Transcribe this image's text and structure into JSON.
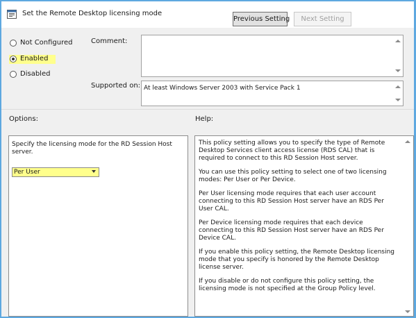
{
  "title": "Set the Remote Desktop licensing mode",
  "buttons": {
    "previous": "Previous Setting",
    "next": "Next Setting"
  },
  "state": {
    "options": [
      "Not Configured",
      "Enabled",
      "Disabled"
    ],
    "selected": "Enabled"
  },
  "comment": {
    "label": "Comment:",
    "value": ""
  },
  "supported_on": {
    "label": "Supported on:",
    "value": "At least Windows Server 2003 with Service Pack 1"
  },
  "options_panel": {
    "heading": "Options:",
    "description": "Specify the licensing mode for the RD Session Host server.",
    "licensing_mode": {
      "selected": "Per User"
    }
  },
  "help_panel": {
    "heading": "Help:",
    "paragraphs": [
      "This policy setting allows you to specify the type of Remote Desktop Services client access license (RDS CAL) that is required to connect to this RD Session Host server.",
      "You can use this policy setting to select one of two licensing modes: Per User or Per Device.",
      "Per User licensing mode requires that each user account connecting to this RD Session Host server have an RDS Per User CAL.",
      "Per Device licensing mode requires that each device connecting to this RD Session Host server have an RDS Per Device CAL.",
      "If you enable this policy setting, the Remote Desktop licensing mode that you specify is honored by the Remote Desktop license server.",
      "If you disable or do not configure this policy setting, the licensing mode is not specified at the Group Policy level."
    ]
  },
  "colors": {
    "highlight": "#ffff8c",
    "window_border": "#5ea8e0",
    "dialog_background": "#f0f0f0"
  }
}
